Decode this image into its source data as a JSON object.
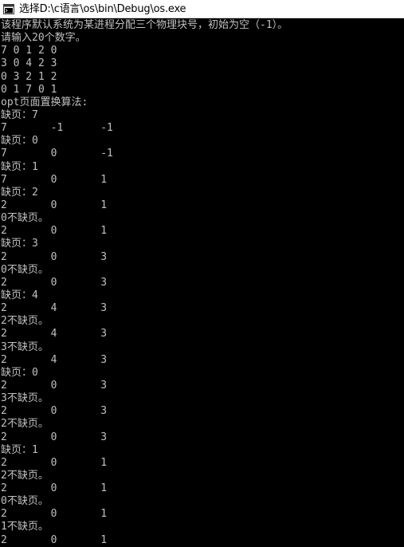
{
  "window": {
    "title": "选择D:\\c语言\\os\\bin\\Debug\\os.exe",
    "icon": "console-app-icon"
  },
  "colors": {
    "console_background": "#000000",
    "console_text": "#c0c0c0",
    "titlebar_background": "#ffffff"
  },
  "console": {
    "lines": [
      "该程序默认系统为某进程分配三个物理块号，初始为空（-1）。",
      "请输入20个数字。",
      "7 0 1 2 0",
      "3 0 4 2 3",
      "0 3 2 1 2",
      "0 1 7 0 1",
      "opt页面置换算法:",
      "缺页：7",
      "7       -1      -1",
      "缺页：0",
      "7       0       -1",
      "缺页：1",
      "7       0       1",
      "缺页：2",
      "2       0       1",
      "0不缺页。",
      "2       0       1",
      "缺页：3",
      "2       0       3",
      "0不缺页。",
      "2       0       3",
      "缺页：4",
      "2       4       3",
      "2不缺页。",
      "2       4       3",
      "3不缺页。",
      "2       4       3",
      "缺页：0",
      "2       0       3",
      "3不缺页。",
      "2       0       3",
      "2不缺页。",
      "2       0       3",
      "缺页：1",
      "2       0       1",
      "2不缺页。",
      "2       0       1",
      "0不缺页。",
      "2       0       1",
      "1不缺页。",
      "2       0       1"
    ]
  }
}
